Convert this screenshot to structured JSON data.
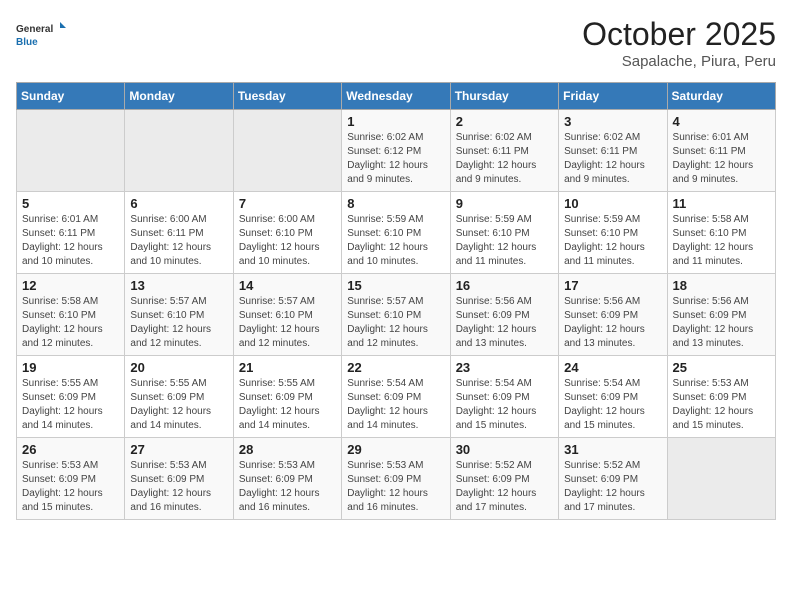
{
  "header": {
    "logo_general": "General",
    "logo_blue": "Blue",
    "month_title": "October 2025",
    "subtitle": "Sapalache, Piura, Peru"
  },
  "days_of_week": [
    "Sunday",
    "Monday",
    "Tuesday",
    "Wednesday",
    "Thursday",
    "Friday",
    "Saturday"
  ],
  "weeks": [
    [
      {
        "day": "",
        "info": ""
      },
      {
        "day": "",
        "info": ""
      },
      {
        "day": "",
        "info": ""
      },
      {
        "day": "1",
        "info": "Sunrise: 6:02 AM\nSunset: 6:12 PM\nDaylight: 12 hours and 9 minutes."
      },
      {
        "day": "2",
        "info": "Sunrise: 6:02 AM\nSunset: 6:11 PM\nDaylight: 12 hours and 9 minutes."
      },
      {
        "day": "3",
        "info": "Sunrise: 6:02 AM\nSunset: 6:11 PM\nDaylight: 12 hours and 9 minutes."
      },
      {
        "day": "4",
        "info": "Sunrise: 6:01 AM\nSunset: 6:11 PM\nDaylight: 12 hours and 9 minutes."
      }
    ],
    [
      {
        "day": "5",
        "info": "Sunrise: 6:01 AM\nSunset: 6:11 PM\nDaylight: 12 hours and 10 minutes."
      },
      {
        "day": "6",
        "info": "Sunrise: 6:00 AM\nSunset: 6:11 PM\nDaylight: 12 hours and 10 minutes."
      },
      {
        "day": "7",
        "info": "Sunrise: 6:00 AM\nSunset: 6:10 PM\nDaylight: 12 hours and 10 minutes."
      },
      {
        "day": "8",
        "info": "Sunrise: 5:59 AM\nSunset: 6:10 PM\nDaylight: 12 hours and 10 minutes."
      },
      {
        "day": "9",
        "info": "Sunrise: 5:59 AM\nSunset: 6:10 PM\nDaylight: 12 hours and 11 minutes."
      },
      {
        "day": "10",
        "info": "Sunrise: 5:59 AM\nSunset: 6:10 PM\nDaylight: 12 hours and 11 minutes."
      },
      {
        "day": "11",
        "info": "Sunrise: 5:58 AM\nSunset: 6:10 PM\nDaylight: 12 hours and 11 minutes."
      }
    ],
    [
      {
        "day": "12",
        "info": "Sunrise: 5:58 AM\nSunset: 6:10 PM\nDaylight: 12 hours and 12 minutes."
      },
      {
        "day": "13",
        "info": "Sunrise: 5:57 AM\nSunset: 6:10 PM\nDaylight: 12 hours and 12 minutes."
      },
      {
        "day": "14",
        "info": "Sunrise: 5:57 AM\nSunset: 6:10 PM\nDaylight: 12 hours and 12 minutes."
      },
      {
        "day": "15",
        "info": "Sunrise: 5:57 AM\nSunset: 6:10 PM\nDaylight: 12 hours and 12 minutes."
      },
      {
        "day": "16",
        "info": "Sunrise: 5:56 AM\nSunset: 6:09 PM\nDaylight: 12 hours and 13 minutes."
      },
      {
        "day": "17",
        "info": "Sunrise: 5:56 AM\nSunset: 6:09 PM\nDaylight: 12 hours and 13 minutes."
      },
      {
        "day": "18",
        "info": "Sunrise: 5:56 AM\nSunset: 6:09 PM\nDaylight: 12 hours and 13 minutes."
      }
    ],
    [
      {
        "day": "19",
        "info": "Sunrise: 5:55 AM\nSunset: 6:09 PM\nDaylight: 12 hours and 14 minutes."
      },
      {
        "day": "20",
        "info": "Sunrise: 5:55 AM\nSunset: 6:09 PM\nDaylight: 12 hours and 14 minutes."
      },
      {
        "day": "21",
        "info": "Sunrise: 5:55 AM\nSunset: 6:09 PM\nDaylight: 12 hours and 14 minutes."
      },
      {
        "day": "22",
        "info": "Sunrise: 5:54 AM\nSunset: 6:09 PM\nDaylight: 12 hours and 14 minutes."
      },
      {
        "day": "23",
        "info": "Sunrise: 5:54 AM\nSunset: 6:09 PM\nDaylight: 12 hours and 15 minutes."
      },
      {
        "day": "24",
        "info": "Sunrise: 5:54 AM\nSunset: 6:09 PM\nDaylight: 12 hours and 15 minutes."
      },
      {
        "day": "25",
        "info": "Sunrise: 5:53 AM\nSunset: 6:09 PM\nDaylight: 12 hours and 15 minutes."
      }
    ],
    [
      {
        "day": "26",
        "info": "Sunrise: 5:53 AM\nSunset: 6:09 PM\nDaylight: 12 hours and 15 minutes."
      },
      {
        "day": "27",
        "info": "Sunrise: 5:53 AM\nSunset: 6:09 PM\nDaylight: 12 hours and 16 minutes."
      },
      {
        "day": "28",
        "info": "Sunrise: 5:53 AM\nSunset: 6:09 PM\nDaylight: 12 hours and 16 minutes."
      },
      {
        "day": "29",
        "info": "Sunrise: 5:53 AM\nSunset: 6:09 PM\nDaylight: 12 hours and 16 minutes."
      },
      {
        "day": "30",
        "info": "Sunrise: 5:52 AM\nSunset: 6:09 PM\nDaylight: 12 hours and 17 minutes."
      },
      {
        "day": "31",
        "info": "Sunrise: 5:52 AM\nSunset: 6:09 PM\nDaylight: 12 hours and 17 minutes."
      },
      {
        "day": "",
        "info": ""
      }
    ]
  ]
}
